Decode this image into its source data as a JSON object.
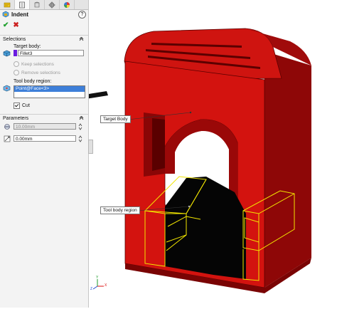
{
  "panel": {
    "tabs": [
      {
        "name": "feature-manager"
      },
      {
        "name": "property-manager"
      },
      {
        "name": "configuration-manager"
      },
      {
        "name": "dimxpert-manager"
      },
      {
        "name": "display-manager"
      }
    ],
    "title": "Indent",
    "help": "?",
    "ok_symbol": "✔",
    "cancel_symbol": "✖",
    "selections": {
      "header": "Selections",
      "target_body_label": "Target body:",
      "target_body_value": "Fillet3",
      "keep_selections": "Keep selections",
      "remove_selections": "Remove selections",
      "tool_body_label": "Tool body region:",
      "tool_body_value": "Point@Face<3>",
      "cut_label": "Cut",
      "cut_checked": true
    },
    "parameters": {
      "header": "Parameters",
      "thickness_value": "10.00mm",
      "clearance_value": "0.00mm"
    }
  },
  "viewport": {
    "callouts": {
      "target_body": "Target Body",
      "tool_body_region": "Tool body region"
    },
    "colors": {
      "body_red": "#d0120f",
      "body_dark": "#8e0707",
      "selection_yellow": "#f2e600"
    },
    "triad": {
      "x": "X",
      "y": "Y",
      "z": "Z"
    }
  }
}
